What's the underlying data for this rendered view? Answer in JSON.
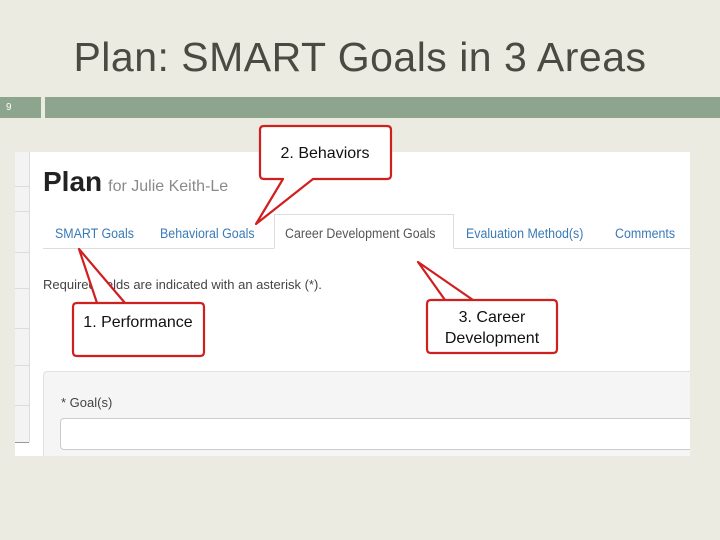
{
  "slide": {
    "title": "Plan: SMART Goals in 3 Areas",
    "number": "9"
  },
  "screenshot": {
    "heading": "Plan",
    "subheading": "for Julie Keith-Le",
    "tabs": [
      {
        "label": "SMART Goals",
        "active": false
      },
      {
        "label": "Behavioral Goals",
        "active": false
      },
      {
        "label": "Career Development Goals",
        "active": true
      },
      {
        "label": "Evaluation Method(s)",
        "active": false
      },
      {
        "label": "Comments",
        "active": false
      }
    ],
    "required_note": "Required fields are indicated with an asterisk (*).",
    "goal_label": "* Goal(s)",
    "goal_value": ""
  },
  "callouts": {
    "behaviors": "2. Behaviors",
    "performance": "1. Performance",
    "career": "3. Career Development"
  },
  "colors": {
    "background": "#ecebe1",
    "accent_bar": "#8da58c",
    "tab_link": "#3a7ab8",
    "callout_border": "#d01f1f"
  }
}
